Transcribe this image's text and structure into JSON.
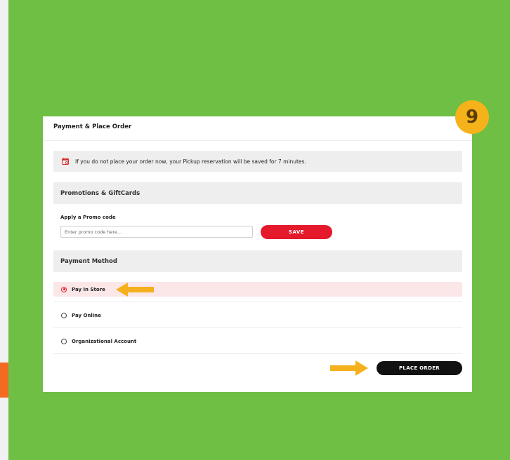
{
  "step_badge": "9",
  "card": {
    "title": "Payment & Place Order"
  },
  "notice": {
    "icon": "calendar-icon",
    "text": "If you do not place your order now, your Pickup reservation will be saved for 7 minutes."
  },
  "promotions": {
    "heading": "Promotions & GiftCards",
    "promo_label": "Apply a Promo code",
    "promo_placeholder": "Enter promo code here...",
    "promo_value": "",
    "save_label": "SAVE"
  },
  "payment": {
    "heading": "Payment Method",
    "options": [
      {
        "label": "Pay In Store",
        "selected": true
      },
      {
        "label": "Pay Online",
        "selected": false
      },
      {
        "label": "Organizational Account",
        "selected": false
      }
    ]
  },
  "place_order_label": "PLACE ORDER",
  "colors": {
    "background": "#6fbf44",
    "accent_red": "#e4192c",
    "badge": "#f6b21a",
    "arrow": "#f5b01e",
    "button_dark": "#111111"
  }
}
